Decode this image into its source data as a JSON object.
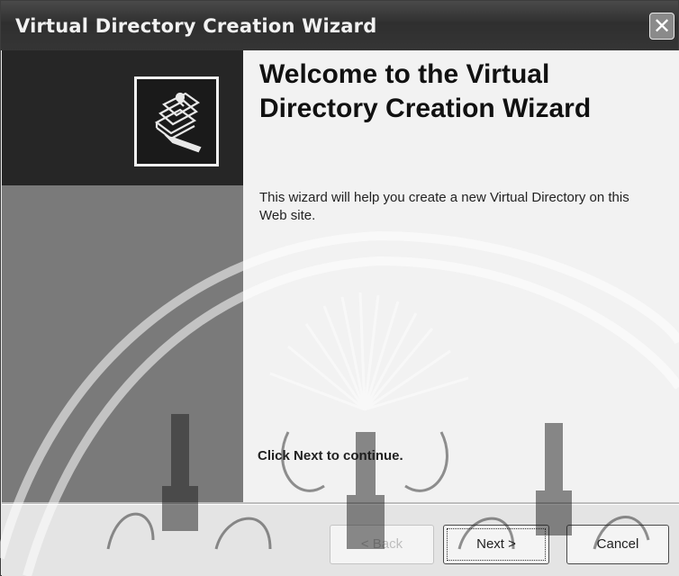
{
  "window": {
    "title": "Virtual Directory Creation Wizard",
    "close_glyph": "✕"
  },
  "main": {
    "heading": "Welcome to the Virtual Directory Creation Wizard",
    "description": "This wizard will help you create a new Virtual Directory on this Web site.",
    "continue_hint": "Click Next to continue."
  },
  "buttons": {
    "back_label": "< Back",
    "next_label": "Next >",
    "cancel_label": "Cancel"
  },
  "icons": {
    "wizard": "books-with-pen-icon",
    "close": "close-icon",
    "watermark": "university-seal-watermark"
  },
  "colors": {
    "banner": "#262626",
    "side_panel": "#7a7a7a",
    "content_bg": "#f2f2f2"
  }
}
